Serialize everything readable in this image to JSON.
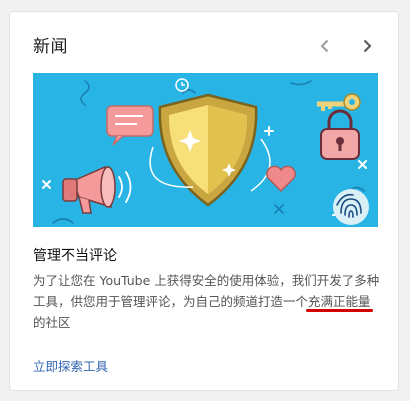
{
  "news_card": {
    "title": "新闻",
    "prev_icon": "chevron-left-icon",
    "next_icon": "chevron-right-icon",
    "banner_icons": [
      "shield-icon",
      "megaphone-icon",
      "padlock-icon",
      "key-icon",
      "heart-icon",
      "fingerprint-icon",
      "chat-bubble-icon",
      "clock-icon"
    ],
    "article": {
      "title": "管理不当评论",
      "body_part1": "为了让您在 YouTube 上获得安全的使用体验，我们开发了多种工具，供您用于管理评论，为自己的频道打造一个",
      "body_highlight": "充满正能量",
      "body_part2": "的社区"
    },
    "link": "立即探索工具"
  },
  "colors": {
    "banner_bg": "#28b5e6",
    "highlight_underline": "#d40000",
    "link": "#3366b2"
  }
}
